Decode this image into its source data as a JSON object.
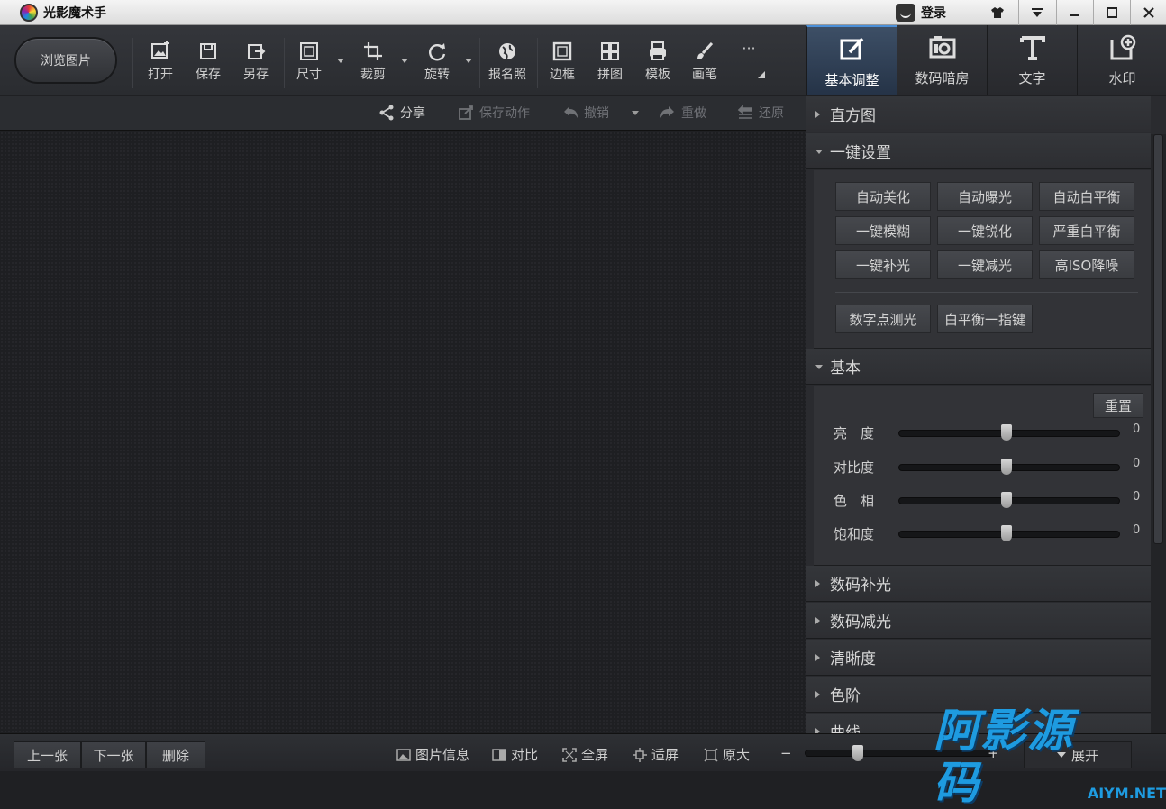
{
  "titlebar": {
    "app_title": "光影魔术手",
    "login_label": "登录"
  },
  "toolbar": {
    "browse_label": "浏览图片",
    "tools": {
      "open": "打开",
      "save": "保存",
      "saveas": "另存",
      "size": "尺寸",
      "crop": "裁剪",
      "rotate": "旋转",
      "idphoto": "报名照",
      "border": "边框",
      "collage": "拼图",
      "template": "模板",
      "brush": "画笔",
      "more": "···"
    }
  },
  "subtoolbar": {
    "share": "分享",
    "save_action": "保存动作",
    "undo": "撤销",
    "redo": "重做",
    "restore": "还原"
  },
  "right_tabs": {
    "basic": "基本调整",
    "darkroom": "数码暗房",
    "text": "文字",
    "watermark": "水印"
  },
  "panel": {
    "histogram": "直方图",
    "oneclick": {
      "title": "一键设置",
      "buttons": [
        "自动美化",
        "自动曝光",
        "自动白平衡",
        "一键模糊",
        "一键锐化",
        "严重白平衡",
        "一键补光",
        "一键减光",
        "高ISO降噪"
      ],
      "extra": [
        "数字点测光",
        "白平衡一指键"
      ]
    },
    "basic": {
      "title": "基本",
      "reset": "重置",
      "sliders": [
        {
          "label": "亮　度",
          "value": "0"
        },
        {
          "label": "对比度",
          "value": "0"
        },
        {
          "label": "色　相",
          "value": "0"
        },
        {
          "label": "饱和度",
          "value": "0"
        }
      ]
    },
    "sections": [
      "数码补光",
      "数码减光",
      "清晰度",
      "色阶",
      "曲线"
    ]
  },
  "bottombar": {
    "prev": "上一张",
    "next": "下一张",
    "delete": "删除",
    "info": "图片信息",
    "compare": "对比",
    "fullscreen": "全屏",
    "fit": "适屏",
    "original": "原大",
    "zoom_minus": "−",
    "zoom_plus": "+",
    "expand": "展开"
  },
  "watermark": {
    "main": "阿影源码",
    "sub": "AIYM.NET"
  },
  "colors": {
    "accent": "#4b8fd8",
    "watermark": "#1e9be0"
  }
}
